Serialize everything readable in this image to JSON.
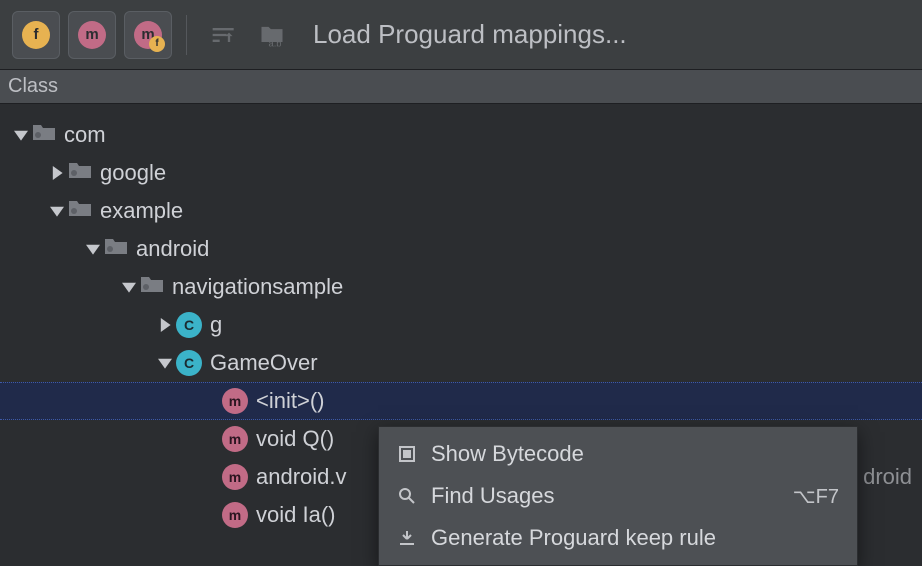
{
  "toolbar": {
    "btn1_letter": "f",
    "btn2_letter": "m",
    "btn3_letter": "m",
    "btn3_overlay": "f",
    "label": "Load Proguard mappings..."
  },
  "header": {
    "col1": "Class"
  },
  "tree": {
    "n0": "com",
    "n1": "google",
    "n2": "example",
    "n3": "android",
    "n4": "navigationsample",
    "n5": "g",
    "n6": "GameOver",
    "n7": "<init>()",
    "n8": "void Q()",
    "n9": "android.v",
    "n9_trail": "droid",
    "n10": "void Ia()"
  },
  "menu": {
    "item1": "Show Bytecode",
    "item2": "Find Usages",
    "item2_shortcut": "⌥F7",
    "item3": "Generate Proguard keep rule"
  }
}
